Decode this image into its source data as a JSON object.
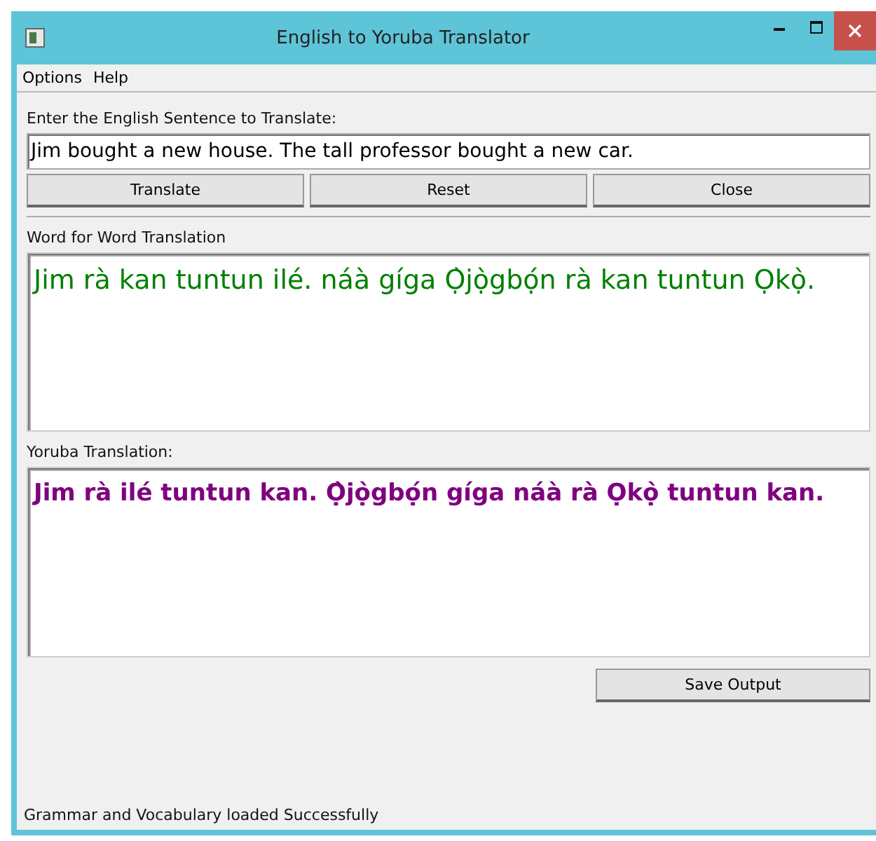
{
  "window": {
    "title": "English to Yoruba Translator"
  },
  "menu": [
    {
      "label": "Options"
    },
    {
      "label": "Help"
    }
  ],
  "input": {
    "label": "Enter the English Sentence to Translate:",
    "value": "Jim bought a new house. The tall professor bought a new car."
  },
  "buttons": [
    "Translate",
    "Reset",
    "Close"
  ],
  "word_for_word": {
    "label": "Word for Word Translation",
    "text": "Jim rà kan tuntun ilé. náà gíga Ọ̀jọ̀gbọ́n rà kan tuntun Ọkọ̀.",
    "color": "#008000"
  },
  "yoruba": {
    "label": "Yoruba Translation:",
    "text": "Jim rà ilé tuntun kan. Ọ̀jọ̀gbọ́n gíga náà rà Ọkọ̀ tuntun kan.",
    "color": "#800080"
  },
  "save_button": "Save Output",
  "status_bar": "Grammar and Vocabulary loaded Successfully"
}
